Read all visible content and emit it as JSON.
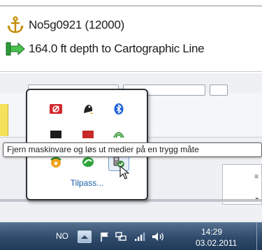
{
  "info_panel": {
    "object_icon": "anchor-icon",
    "object_label": "No5g0921 (12000)",
    "depth_icon": "depth-arrow-icon",
    "depth_label": "164.0 ft depth to Cartographic Line"
  },
  "tray_popup": {
    "icons": [
      {
        "name": "red-shield-icon",
        "color": "#d4262e"
      },
      {
        "name": "penguin-icon",
        "color": "#222222"
      },
      {
        "name": "bluetooth-icon",
        "color": "#1d5fd6"
      },
      {
        "name": "black-device-icon",
        "color": "#1c1c1c"
      },
      {
        "name": "red-device-icon",
        "color": "#c72a2a"
      },
      {
        "name": "green-signal-icon",
        "color": "#3e9b3a"
      },
      {
        "name": "orange-badge-icon",
        "color": "#f0a21c"
      },
      {
        "name": "green-gesture-icon",
        "color": "#2ea43a"
      },
      {
        "name": "safely-remove-hardware-icon",
        "color": "#3c8d3c"
      }
    ],
    "customize_label": "Tilpass..."
  },
  "tooltip": {
    "text": "Fjern maskinvare og løs ut medier på en trygg måte"
  },
  "taskbar": {
    "language": "NO",
    "tray_icons": [
      "show-hidden-icons-icon",
      "flag-icon",
      "network-icon",
      "signal-bars-icon",
      "volume-icon"
    ],
    "time": "14:29",
    "date": "03.02.2011"
  },
  "colors": {
    "taskbar": "#2f4a6b",
    "link": "#1a5ea8",
    "tooltip_border": "#5b5b5b"
  }
}
